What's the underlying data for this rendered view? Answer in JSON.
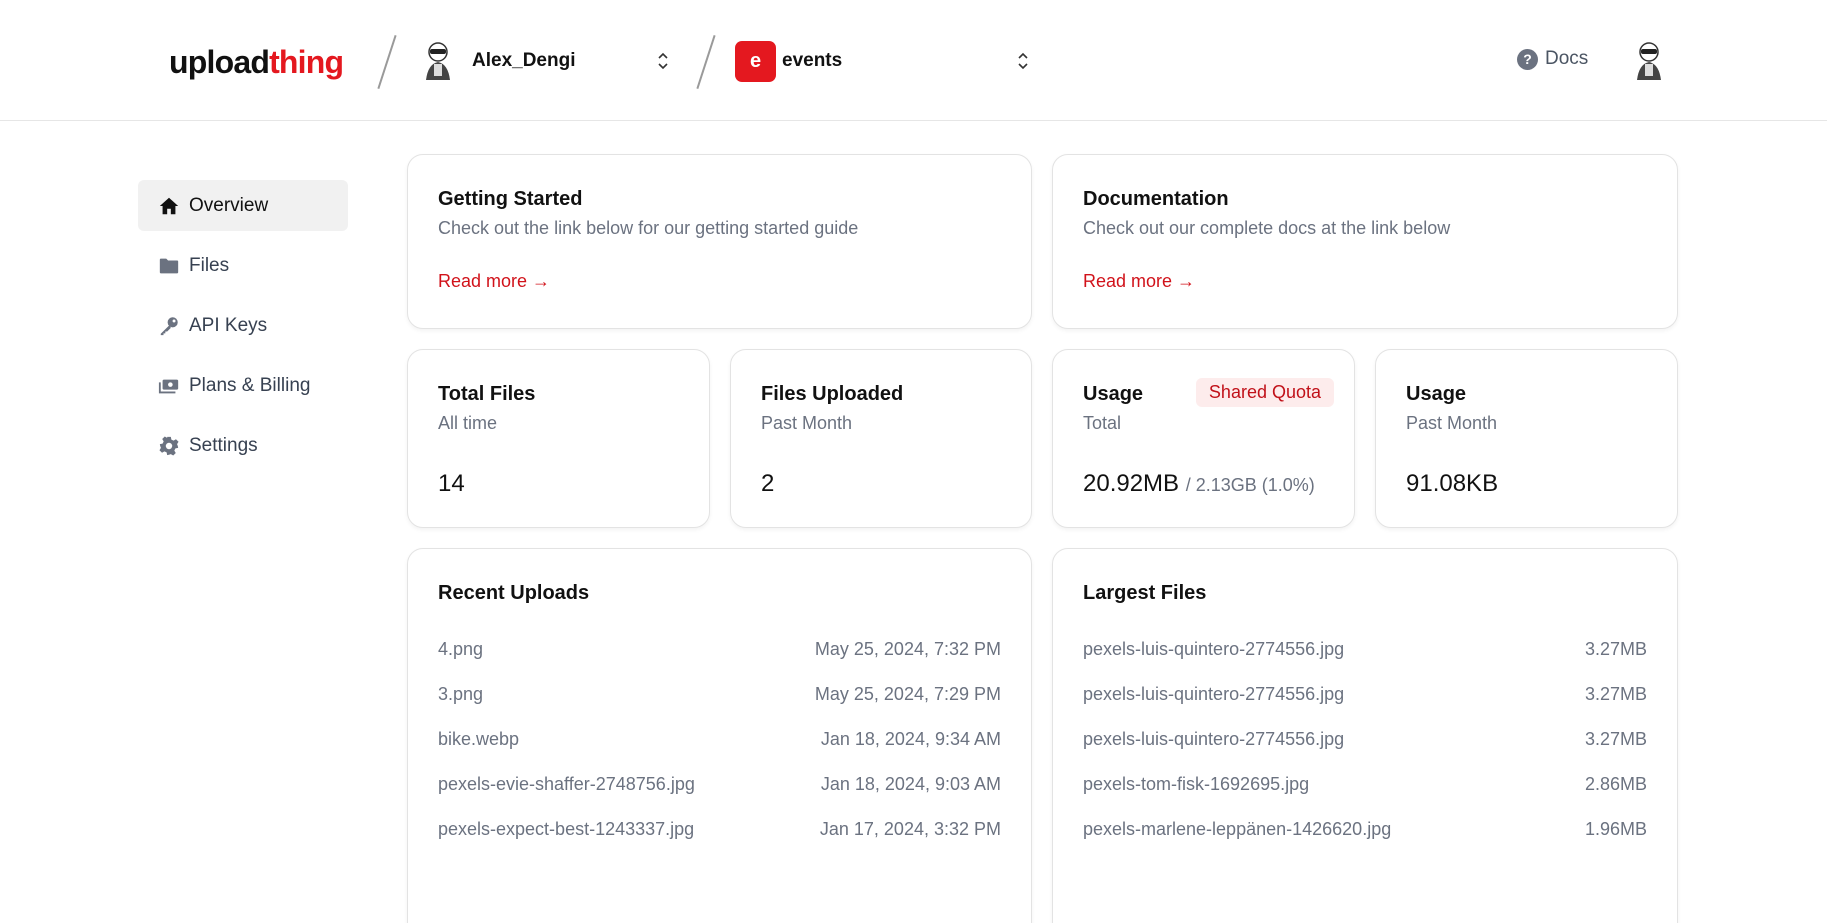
{
  "header": {
    "logo_part1": "upload",
    "logo_part2": "thing",
    "account_name": "Alex_Dengi",
    "app_initial": "e",
    "app_name": "events",
    "docs_label": "Docs"
  },
  "sidebar": {
    "items": [
      {
        "label": "Overview",
        "icon": "home-icon",
        "active": true
      },
      {
        "label": "Files",
        "icon": "folder-icon"
      },
      {
        "label": "API Keys",
        "icon": "key-icon"
      },
      {
        "label": "Plans & Billing",
        "icon": "billing-icon"
      },
      {
        "label": "Settings",
        "icon": "gear-icon"
      }
    ]
  },
  "cards": {
    "getting_started": {
      "title": "Getting Started",
      "subtitle": "Check out the link below for our getting started guide",
      "link": "Read more →"
    },
    "documentation": {
      "title": "Documentation",
      "subtitle": "Check out our complete docs at the link below",
      "link": "Read more →"
    },
    "total_files": {
      "title": "Total Files",
      "subtitle": "All time",
      "value": "14"
    },
    "files_uploaded": {
      "title": "Files Uploaded",
      "subtitle": "Past Month",
      "value": "2"
    },
    "usage_total": {
      "title": "Usage",
      "subtitle": "Total",
      "badge": "Shared Quota",
      "value": "20.92MB",
      "limit": "/ 2.13GB (1.0%)"
    },
    "usage_month": {
      "title": "Usage",
      "subtitle": "Past Month",
      "value": "91.08KB"
    }
  },
  "recent_uploads": {
    "title": "Recent Uploads",
    "rows": [
      {
        "name": "4.png",
        "date": "May 25, 2024, 7:32 PM"
      },
      {
        "name": "3.png",
        "date": "May 25, 2024, 7:29 PM"
      },
      {
        "name": "bike.webp",
        "date": "Jan 18, 2024, 9:34 AM"
      },
      {
        "name": "pexels-evie-shaffer-2748756.jpg",
        "date": "Jan 18, 2024, 9:03 AM"
      },
      {
        "name": "pexels-expect-best-1243337.jpg",
        "date": "Jan 17, 2024, 3:32 PM"
      }
    ]
  },
  "largest_files": {
    "title": "Largest Files",
    "rows": [
      {
        "name": "pexels-luis-quintero-2774556.jpg",
        "size": "3.27MB"
      },
      {
        "name": "pexels-luis-quintero-2774556.jpg",
        "size": "3.27MB"
      },
      {
        "name": "pexels-luis-quintero-2774556.jpg",
        "size": "3.27MB"
      },
      {
        "name": "pexels-tom-fisk-1692695.jpg",
        "size": "2.86MB"
      },
      {
        "name": "pexels-marlene-leppänen-1426620.jpg",
        "size": "1.96MB"
      }
    ]
  },
  "colors": {
    "brand": "#e4181f",
    "link": "#d1121a",
    "muted": "#6b7280"
  }
}
